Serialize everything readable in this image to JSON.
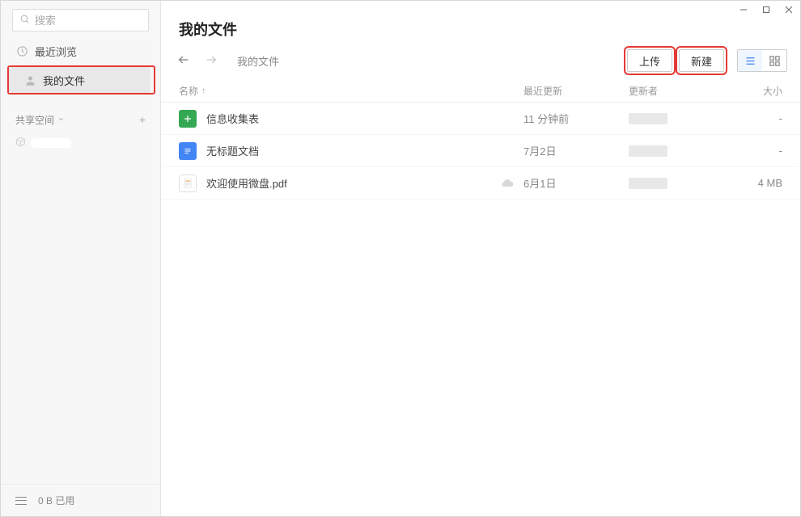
{
  "search": {
    "placeholder": "搜索"
  },
  "sidebar": {
    "items": [
      {
        "label": "最近浏览"
      },
      {
        "label": "我的文件"
      }
    ],
    "shared_space_label": "共享空间",
    "footer_usage": "0 B 已用"
  },
  "header": {
    "title": "我的文件",
    "breadcrumb": "我的文件",
    "upload_label": "上传",
    "new_label": "新建"
  },
  "table": {
    "columns": {
      "name": "名称",
      "updated": "最近更新",
      "updater": "更新者",
      "size": "大小"
    },
    "rows": [
      {
        "name": "信息收集表",
        "updated": "11 分钟前",
        "size": "-",
        "icon": "sheet",
        "cloud": false
      },
      {
        "name": "无标题文档",
        "updated": "7月2日",
        "size": "-",
        "icon": "doc",
        "cloud": false
      },
      {
        "name": "欢迎使用微盘.pdf",
        "updated": "6月1日",
        "size": "4 MB",
        "icon": "pdf",
        "cloud": true
      }
    ]
  }
}
